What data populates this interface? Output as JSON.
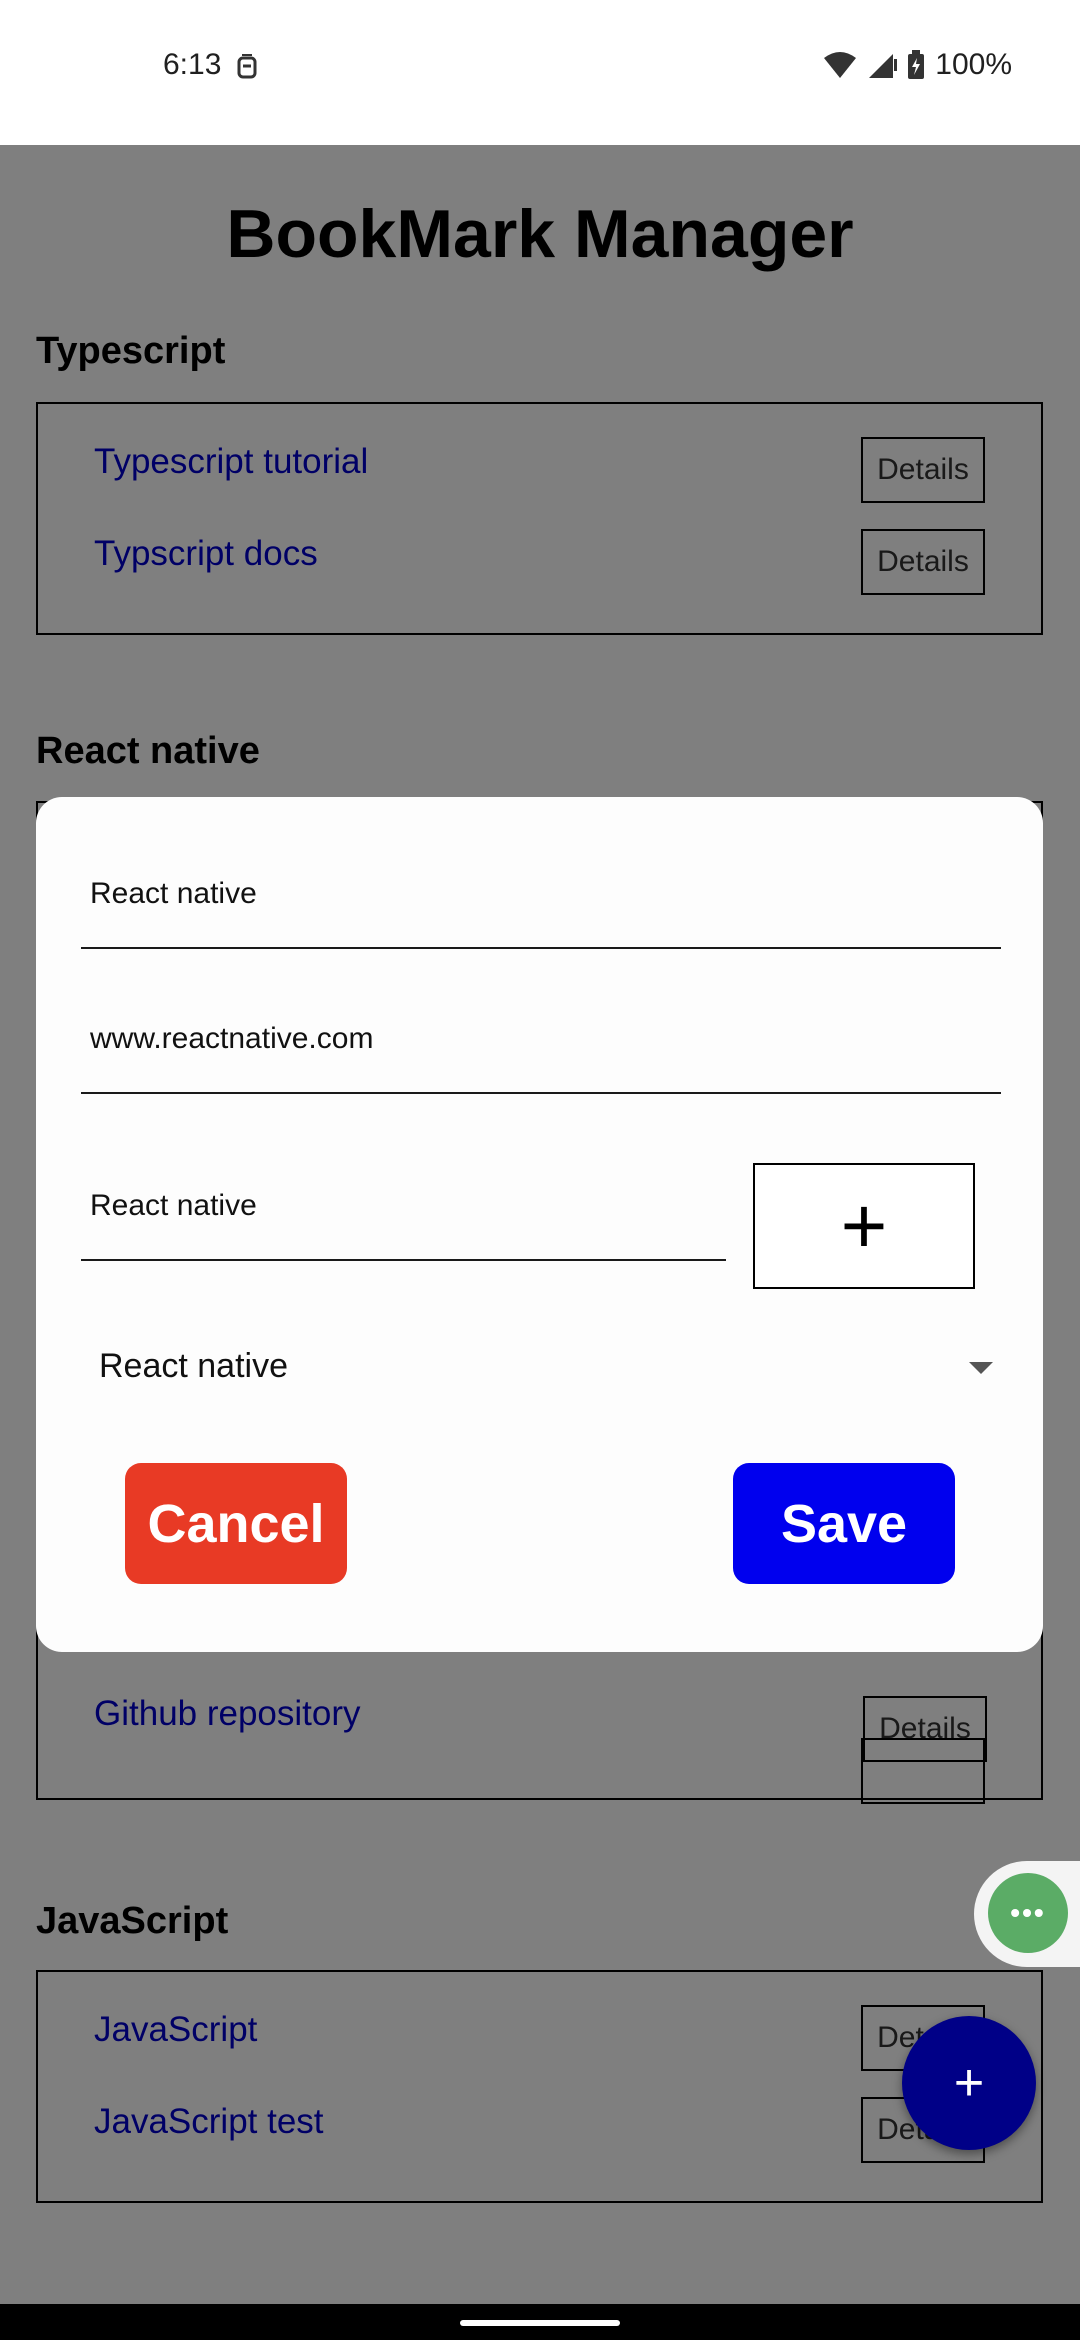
{
  "status_bar": {
    "time": "6:13",
    "battery_text": "100%",
    "icons": [
      "notification-icon",
      "wifi-icon",
      "signal-icon",
      "battery-charging-icon"
    ]
  },
  "app": {
    "title": "BookMark Manager",
    "sections": [
      {
        "name": "Typescript",
        "bookmarks": [
          {
            "label": "Typescript tutorial",
            "details": "Details"
          },
          {
            "label": "Typscript docs",
            "details": "Details"
          }
        ]
      },
      {
        "name": "React native",
        "bookmarks": [
          {
            "label": "Github repository",
            "details": "Details"
          }
        ]
      },
      {
        "name": "JavaScript",
        "bookmarks": [
          {
            "label": "JavaScript",
            "details": "Details"
          },
          {
            "label": "JavaScript test",
            "details": "Details"
          }
        ]
      }
    ]
  },
  "modal": {
    "title_field_value": "React native",
    "url_field_value": "www.reactnative.com",
    "category_field_value": "React native",
    "add_category_label": "+",
    "category_select_value": "React native",
    "cancel_label": "Cancel",
    "save_label": "Save"
  },
  "fab": {
    "label": "+"
  },
  "assistant": {
    "label": "•••"
  },
  "colors": {
    "link": "#0000cc",
    "cancel": "#e83a25",
    "save": "#0000ee",
    "fab": "#000087",
    "assistant": "#5bac66"
  }
}
